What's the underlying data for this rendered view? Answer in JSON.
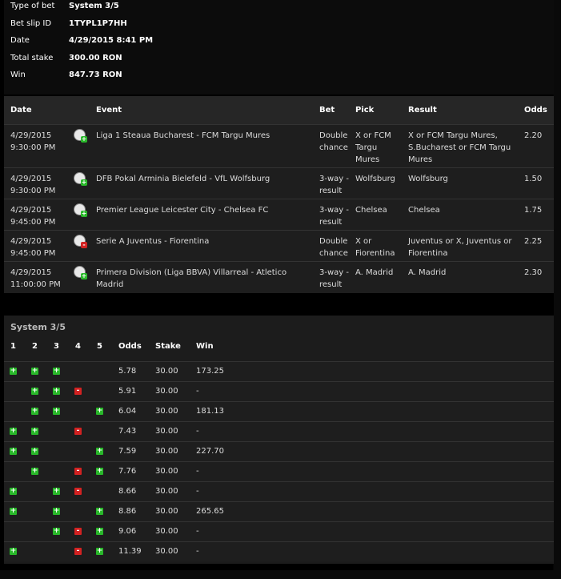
{
  "summary": {
    "type_label": "Type of bet",
    "type_value": "System 3/5",
    "id_label": "Bet slip ID",
    "id_value": "1TYPL1P7HH",
    "date_label": "Date",
    "date_value": "4/29/2015 8:41 PM",
    "stake_label": "Total stake",
    "stake_value": "300.00 RON",
    "win_label": "Win",
    "win_value": "847.73 RON"
  },
  "bets_table": {
    "headers": {
      "date": "Date",
      "event": "Event",
      "bet": "Bet",
      "pick": "Pick",
      "result": "Result",
      "odds": "Odds"
    },
    "rows": [
      {
        "date": "4/29/2015",
        "time": "9:30:00 PM",
        "status": "won",
        "status_icon": "football-won-icon",
        "event": [
          "Liga 1 Steaua Bucharest - FCM Targu Mures"
        ],
        "bet": [
          "Double",
          "chance"
        ],
        "pick": [
          "X or FCM",
          "Targu",
          "Mures"
        ],
        "result": [
          "X or FCM Targu Mures,",
          "S.Bucharest or FCM Targu",
          "Mures"
        ],
        "odds": "2.20"
      },
      {
        "date": "4/29/2015",
        "time": "9:30:00 PM",
        "status": "won",
        "status_icon": "football-won-icon",
        "event": [
          "DFB Pokal Arminia Bielefeld - VfL Wolfsburg"
        ],
        "bet": [
          "3-way -",
          "result"
        ],
        "pick": [
          "Wolfsburg"
        ],
        "result": [
          "Wolfsburg"
        ],
        "odds": "1.50"
      },
      {
        "date": "4/29/2015",
        "time": "9:45:00 PM",
        "status": "won",
        "status_icon": "football-won-icon",
        "event": [
          "Premier League Leicester City - Chelsea FC"
        ],
        "bet": [
          "3-way -",
          "result"
        ],
        "pick": [
          "Chelsea"
        ],
        "result": [
          "Chelsea"
        ],
        "odds": "1.75"
      },
      {
        "date": "4/29/2015",
        "time": "9:45:00 PM",
        "status": "lost",
        "status_icon": "football-lost-icon",
        "event": [
          "Serie A Juventus - Fiorentina"
        ],
        "bet": [
          "Double",
          "chance"
        ],
        "pick": [
          "X or",
          "Fiorentina"
        ],
        "result": [
          "Juventus or X, Juventus or",
          "Fiorentina"
        ],
        "odds": "2.25"
      },
      {
        "date": "4/29/2015",
        "time": "11:00:00 PM",
        "status": "won",
        "status_icon": "football-won-icon",
        "event": [
          "Primera Division (Liga BBVA) Villarreal - Atletico",
          "Madrid"
        ],
        "bet": [
          "3-way -",
          "result"
        ],
        "pick": [
          "A. Madrid"
        ],
        "result": [
          "A. Madrid"
        ],
        "odds": "2.30"
      }
    ]
  },
  "system": {
    "title": "System 3/5",
    "headers": {
      "c1": "1",
      "c2": "2",
      "c3": "3",
      "c4": "4",
      "c5": "5",
      "odds": "Odds",
      "stake": "Stake",
      "win": "Win"
    },
    "win_symbol": "+",
    "lose_symbol": "-",
    "colors": {
      "win": "#29b82a",
      "lose": "#d22222"
    },
    "rows": [
      {
        "marks": [
          "w",
          "w",
          "w",
          "",
          ""
        ],
        "odds": "5.78",
        "stake": "30.00",
        "win": "173.25"
      },
      {
        "marks": [
          "",
          "w",
          "w",
          "l",
          ""
        ],
        "odds": "5.91",
        "stake": "30.00",
        "win": "-"
      },
      {
        "marks": [
          "",
          "w",
          "w",
          "",
          "w"
        ],
        "odds": "6.04",
        "stake": "30.00",
        "win": "181.13"
      },
      {
        "marks": [
          "w",
          "w",
          "",
          "l",
          ""
        ],
        "odds": "7.43",
        "stake": "30.00",
        "win": "-"
      },
      {
        "marks": [
          "w",
          "w",
          "",
          "",
          "w"
        ],
        "odds": "7.59",
        "stake": "30.00",
        "win": "227.70"
      },
      {
        "marks": [
          "",
          "w",
          "",
          "l",
          "w"
        ],
        "odds": "7.76",
        "stake": "30.00",
        "win": "-"
      },
      {
        "marks": [
          "w",
          "",
          "w",
          "l",
          ""
        ],
        "odds": "8.66",
        "stake": "30.00",
        "win": "-"
      },
      {
        "marks": [
          "w",
          "",
          "w",
          "",
          "w"
        ],
        "odds": "8.86",
        "stake": "30.00",
        "win": "265.65"
      },
      {
        "marks": [
          "",
          "",
          "w",
          "l",
          "w"
        ],
        "odds": "9.06",
        "stake": "30.00",
        "win": "-"
      },
      {
        "marks": [
          "w",
          "",
          "",
          "l",
          "w"
        ],
        "odds": "11.39",
        "stake": "30.00",
        "win": "-"
      }
    ]
  }
}
